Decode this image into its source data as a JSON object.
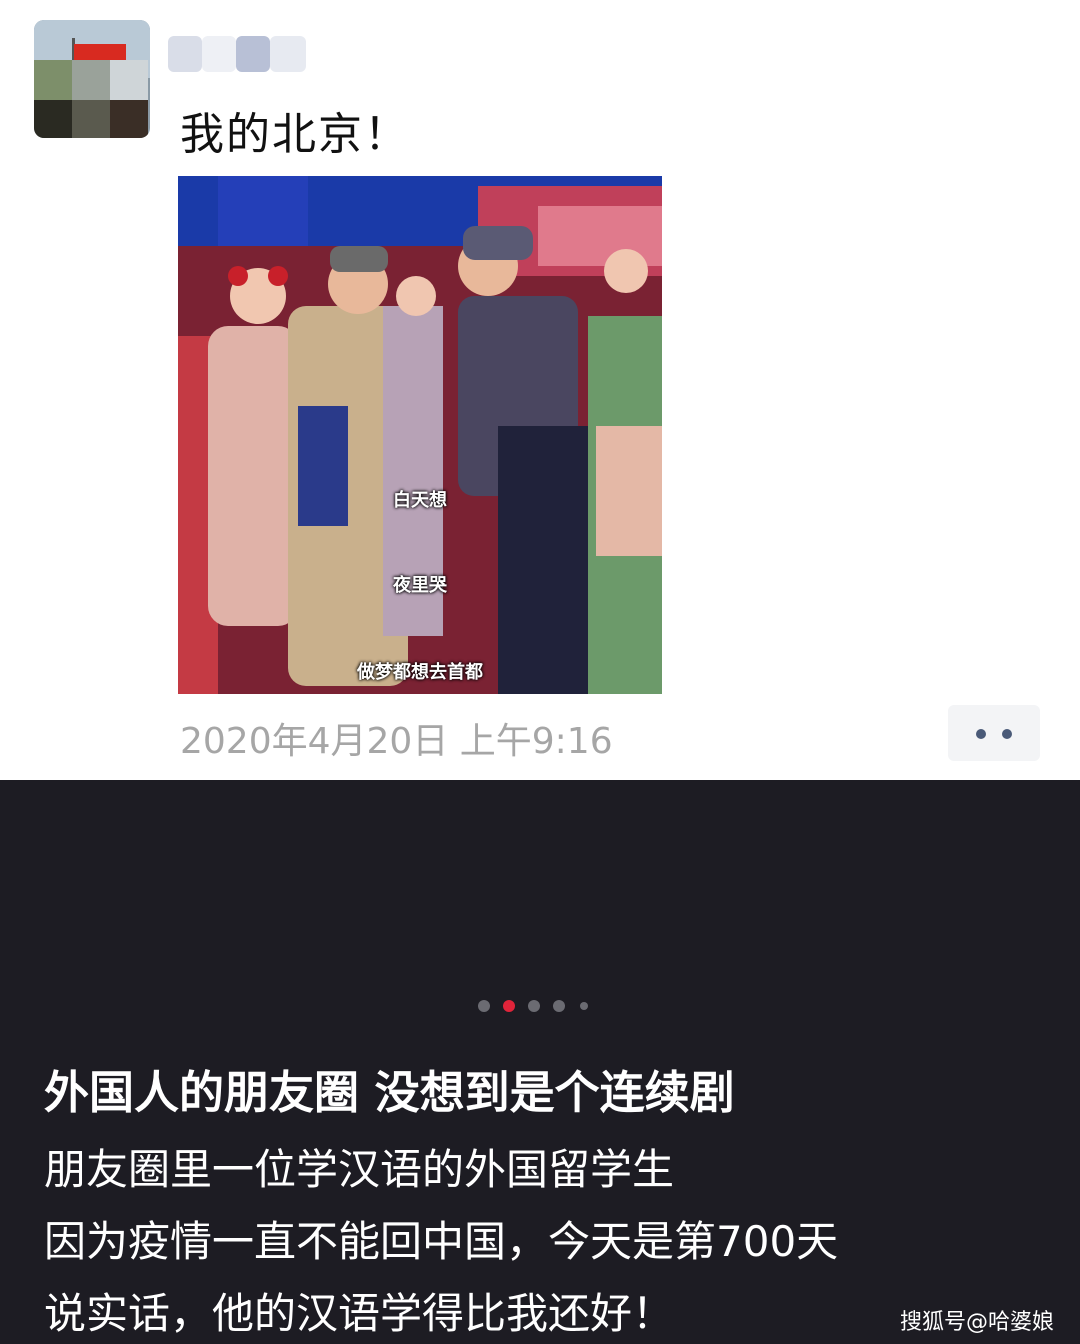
{
  "post": {
    "text": "我的北京！",
    "image_captions": [
      "白天想",
      "夜里哭",
      "做梦都想去首都"
    ],
    "timestamp": "2020年4月20日 上午9:16",
    "more_button": "••"
  },
  "gallery": {
    "page_indicator": {
      "total": 5,
      "active": 2
    }
  },
  "article": {
    "title": "外国人的朋友圈 没想到是个连续剧",
    "lines": [
      "朋友圈里一位学汉语的外国留学生",
      "因为疫情一直不能回中国，今天是第700天",
      "说实话，他的汉语学得比我还好！"
    ]
  },
  "watermark": "搜狐号@哈婆娘",
  "colors": {
    "dark_background": "#1d1c23",
    "timestamp_gray": "#a6a6a6",
    "active_dot": "#e0243a",
    "more_dots": "#4a5a78"
  }
}
